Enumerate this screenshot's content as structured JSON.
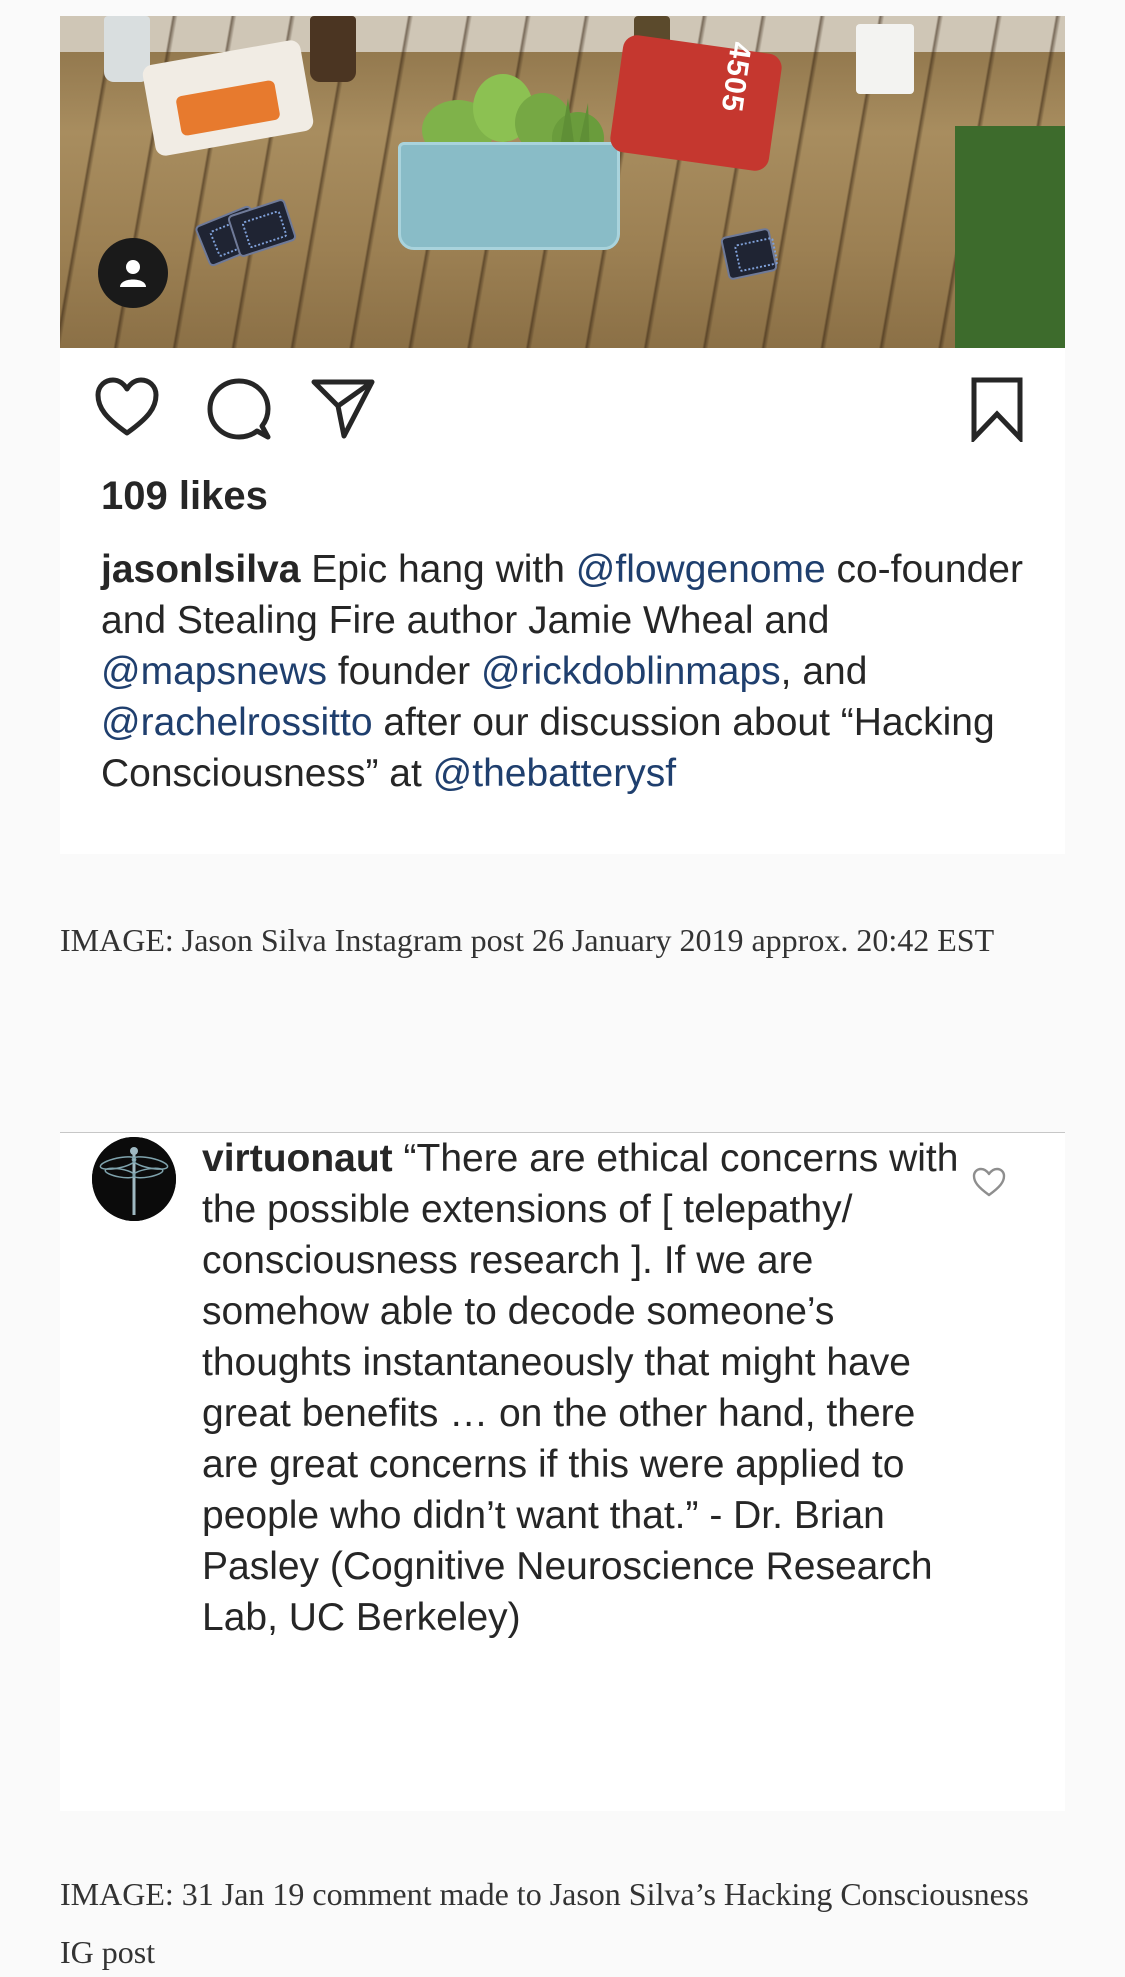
{
  "post": {
    "likes": "109 likes",
    "photo_print": "4505",
    "caption": {
      "username": "jasonlsilva",
      "text_1": " Epic hang with ",
      "mention_1": "@flowgenome",
      "text_2": " co-founder and Stealing Fire author Jamie Wheal and ",
      "mention_2": "@mapsnews",
      "text_3": " founder ",
      "mention_3": "@rickdoblinmaps",
      "text_4": ", and ",
      "mention_4": "@rachelrossitto",
      "text_5": " after our discussion about “Hacking Consciousness” at ",
      "mention_5": "@thebatterysf"
    },
    "icons": [
      "person-icon",
      "heart-icon",
      "comment-icon",
      "share-icon",
      "bookmark-icon"
    ]
  },
  "notes": {
    "first": "IMAGE: Jason Silva Instagram post 26 January 2019 approx. 20:42 EST",
    "second": "IMAGE: 31 Jan 19 comment made to Jason Silva’s Hacking Consciousness IG post"
  },
  "comment": {
    "username": "virtuonaut",
    "text": " “There are ethical concerns with the possible extensions of [ telepathy/ consciousness research ]. If we are somehow able to decode someone’s thoughts instantaneously that might have great benefits … on the other hand, there are great concerns if this were applied to people who didn’t want that.” - Dr. Brian Pasley (Cognitive Neuroscience Research Lab, UC Berkeley)",
    "icons": [
      "dragonfly-avatar-icon",
      "heart-outline-icon"
    ]
  },
  "colors": {
    "mention": "#1f3f6e",
    "text": "#262626",
    "background": "#fafafa"
  }
}
